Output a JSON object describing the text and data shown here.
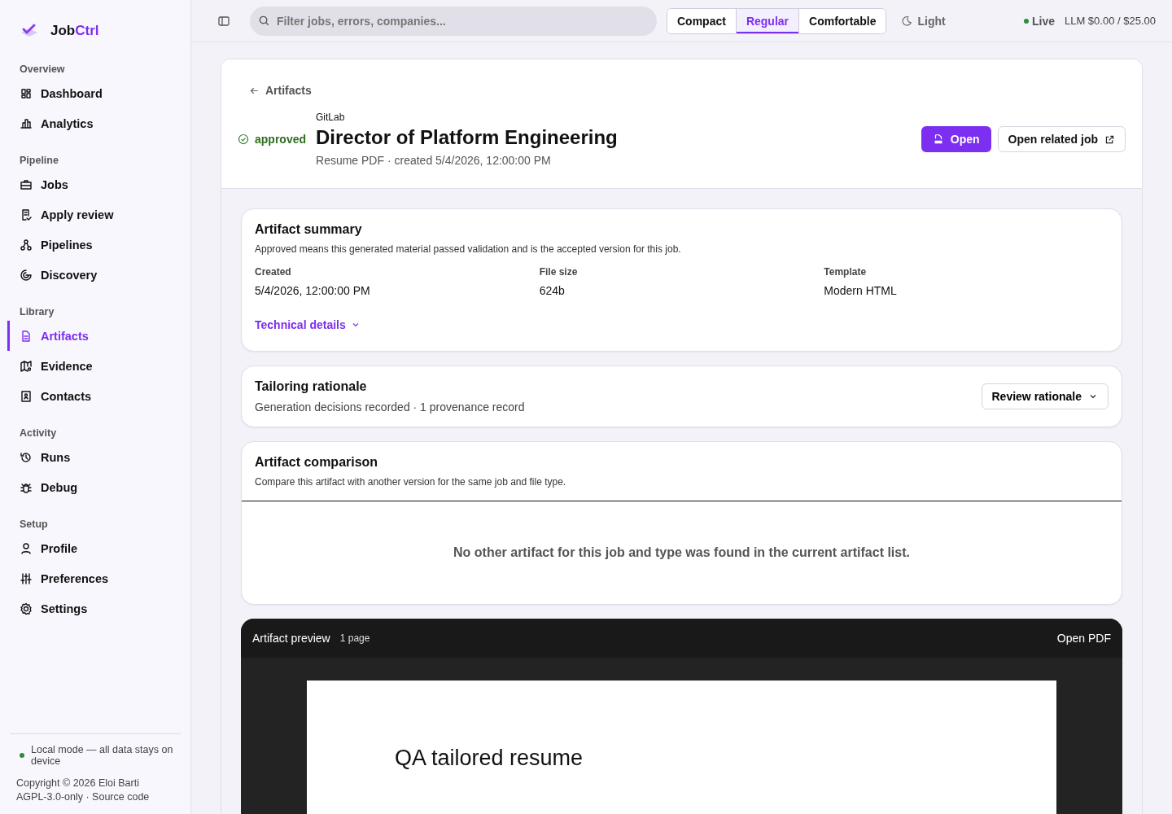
{
  "sidebar": {
    "brand": [
      "Job",
      "Ctrl"
    ],
    "sections": [
      {
        "title": "Overview",
        "items": [
          {
            "label": "Dashboard",
            "selected": false
          },
          {
            "label": "Analytics",
            "selected": false
          }
        ]
      },
      {
        "title": "Pipeline",
        "items": [
          {
            "label": "Jobs",
            "selected": false
          },
          {
            "label": "Apply review",
            "selected": false
          },
          {
            "label": "Pipelines",
            "selected": false
          },
          {
            "label": "Discovery",
            "selected": false
          }
        ]
      },
      {
        "title": "Library",
        "items": [
          {
            "label": "Artifacts",
            "selected": true
          },
          {
            "label": "Evidence",
            "selected": false
          },
          {
            "label": "Contacts",
            "selected": false
          }
        ]
      },
      {
        "title": "Activity",
        "items": [
          {
            "label": "Runs",
            "selected": false
          },
          {
            "label": "Debug",
            "selected": false
          }
        ]
      },
      {
        "title": "Setup",
        "items": [
          {
            "label": "Profile",
            "selected": false
          },
          {
            "label": "Preferences",
            "selected": false
          },
          {
            "label": "Settings",
            "selected": false
          }
        ]
      }
    ],
    "footer": {
      "mode": "Local mode — all data stays on device",
      "copyright": "Copyright © 2026 Eloi Barti",
      "license": "AGPL-3.0-only ·",
      "source_link": "Source code"
    }
  },
  "topbar": {
    "search": {
      "placeholder": "Filter jobs, errors, companies..."
    },
    "density": [
      {
        "label": "Compact",
        "selected": false
      },
      {
        "label": "Regular",
        "selected": true
      },
      {
        "label": "Comfortable",
        "selected": false
      }
    ],
    "theme": "Light",
    "live": "Live",
    "llm": "LLM $0.00 / $25.00"
  },
  "header": {
    "back": "Artifacts",
    "status": "approved",
    "company": "GitLab",
    "title": "Director of Platform Engineering",
    "subtitle": "Resume PDF · created 5/4/2026, 12:00:00 PM",
    "buttons": [
      {
        "label": "Open",
        "kind": "primary"
      },
      {
        "label": "Open related job",
        "kind": "secondary"
      }
    ]
  },
  "summary": {
    "title": "Artifact summary",
    "description": "Approved means this generated material passed validation and is the accepted version for this job.",
    "fields": [
      {
        "label": "Created",
        "value": "5/4/2026, 12:00:00 PM"
      },
      {
        "label": "File size",
        "value": "624b"
      },
      {
        "label": "Template",
        "value": "Modern HTML"
      }
    ],
    "details": {
      "label": "Technical details",
      "expanded": false
    }
  },
  "rationale": {
    "title": "Tailoring rationale",
    "subtitle": "Generation decisions recorded · 1 provenance record",
    "button": "Review rationale"
  },
  "comparison": {
    "title": "Artifact comparison",
    "description": "Compare this artifact with another version for the same job and file type.",
    "empty": "No other artifact for this job and type was found in the current artifact list."
  },
  "preview": {
    "title": "Artifact preview",
    "pages": "1 page",
    "action": "Open PDF",
    "document_heading": "QA tailored resume"
  }
}
